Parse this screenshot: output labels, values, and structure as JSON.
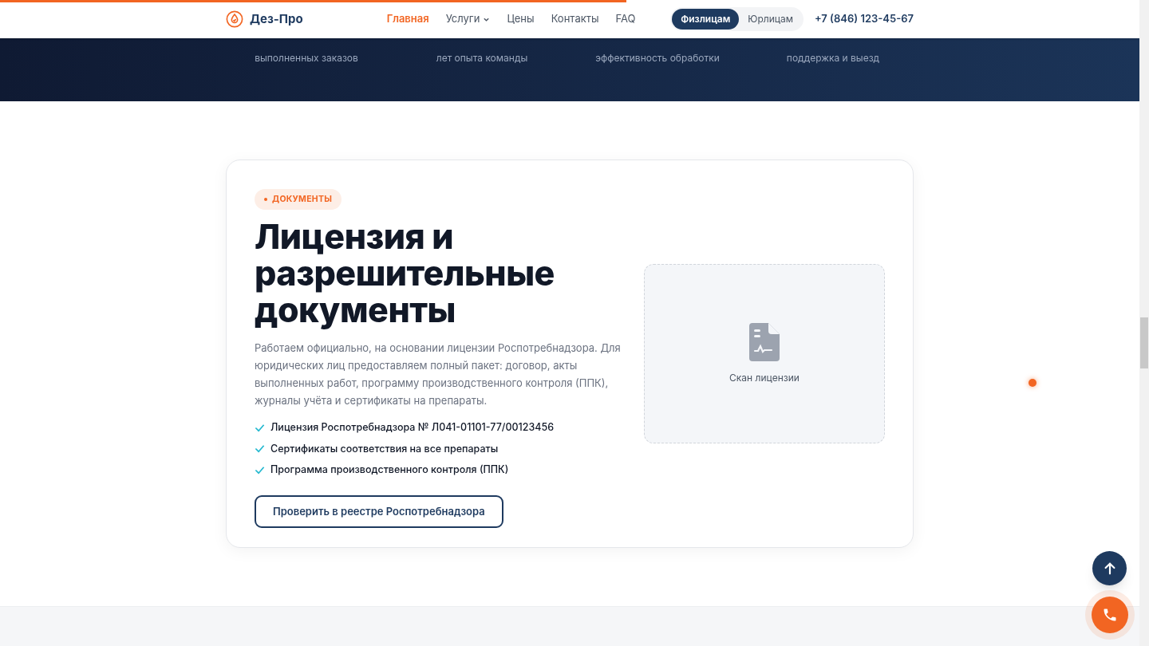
{
  "progress": {
    "level": 0.55
  },
  "header": {
    "logo": "Дез-Про",
    "nav": [
      {
        "label": "Главная",
        "selected": true,
        "dropdown": false
      },
      {
        "label": "Услуги",
        "selected": false,
        "dropdown": true
      },
      {
        "label": "Цены",
        "selected": false,
        "dropdown": false
      },
      {
        "label": "Контакты",
        "selected": false,
        "dropdown": false
      },
      {
        "label": "FAQ",
        "selected": false,
        "dropdown": false
      }
    ],
    "audience": [
      {
        "label": "Физлицам",
        "selected": true
      },
      {
        "label": "Юрлицам",
        "selected": false
      }
    ],
    "phone": "+7 (846) 123-45-67"
  },
  "stats": [
    {
      "label": "выполненных заказов"
    },
    {
      "label": "лет опыта команды"
    },
    {
      "label": "эффективность обработки"
    },
    {
      "label": "поддержка и выезд"
    }
  ],
  "documents": {
    "badge": "ДОКУМЕНТЫ",
    "title": "Лицензия и разрешительные документы",
    "text": "Работаем официально, на основании лицензии Роспотребнадзора. Для юридических лиц предоставляем полный пакет: договор, акты выполненных работ, программу производственного контроля (ППК), журналы учёта и сертификаты на препараты.",
    "items": [
      "Лицензия Роспотребнадзора № Л041-01101-77/00123456",
      "Сертификаты соответствия на все препараты",
      "Программа производственного контроля (ППК)"
    ],
    "button": "Проверить в реестре Роспотребнадзора",
    "scan_caption": "Скан лицензии"
  }
}
